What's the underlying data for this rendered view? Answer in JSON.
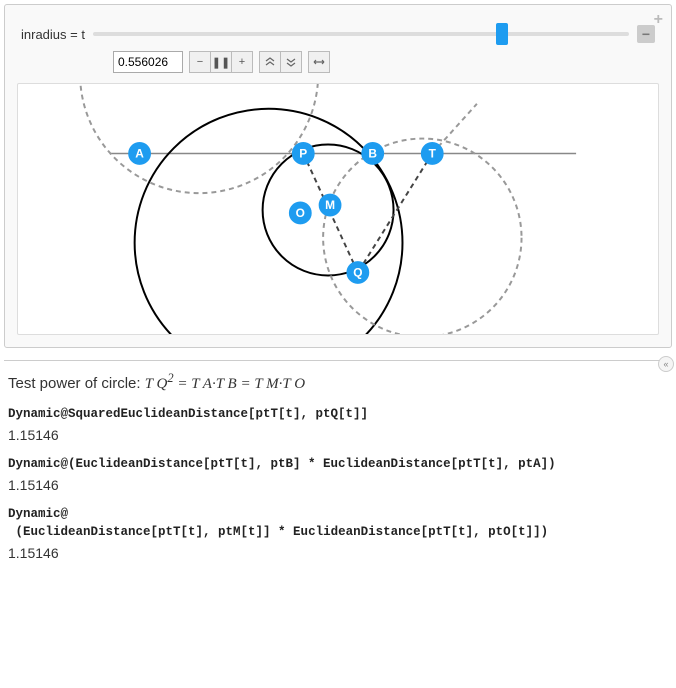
{
  "slider": {
    "label": "inradius = t",
    "value": "0.556026"
  },
  "buttons": {
    "minus_large": "−",
    "minus": "−",
    "pause": "❚❚",
    "plus": "+",
    "dup": "≫",
    "ddown": "≪",
    "lr": "↔",
    "corner_plus": "+",
    "chevron": "«"
  },
  "points": {
    "A": "A",
    "P": "P",
    "B": "B",
    "T": "T",
    "O": "O",
    "M": "M",
    "Q": "Q"
  },
  "caption": {
    "prefix": "Test power of circle: ",
    "eq_a": "T Q",
    "eq_sup": "2",
    "eq_b": " = T A·T B = T M·T O"
  },
  "code1": "Dynamic@SquaredEuclideanDistance[ptT[t], ptQ[t]]",
  "out1": "1.15146",
  "code2": "Dynamic@(EuclideanDistance[ptT[t], ptB] * EuclideanDistance[ptT[t], ptA])",
  "out2": "1.15146",
  "code3a": "Dynamic@",
  "code3b": " (EuclideanDistance[ptT[t], ptM[t]] * EuclideanDistance[ptT[t], ptO[t]])",
  "out3": "1.15146",
  "chart_data": {
    "type": "diagram",
    "parameter": {
      "name": "inradius t",
      "value": 0.556026
    },
    "points": {
      "A": [
        -2.0,
        0
      ],
      "P": [
        -0.35,
        0
      ],
      "B": [
        0.5,
        0
      ],
      "T": [
        1.1,
        0
      ],
      "O": [
        -0.35,
        -0.5
      ],
      "M": [
        -0.05,
        -0.42
      ],
      "Q": [
        0.3,
        -1.0
      ]
    },
    "horizontal_axis_y": 0,
    "circles": [
      {
        "style": "solid",
        "center_approx": [
          -0.75,
          -0.7
        ],
        "r_approx": 1.3
      },
      {
        "style": "solid",
        "center_approx": [
          -0.05,
          -0.42
        ],
        "r_approx": 0.65
      },
      {
        "style": "dashed",
        "center_approx": [
          -1.45,
          0.6
        ],
        "r_approx": 1.2,
        "partial": true
      },
      {
        "style": "dashed",
        "center_approx": [
          0.75,
          -0.75
        ],
        "r_approx": 0.95,
        "partial": true
      }
    ],
    "dashed_segments": [
      [
        "P",
        "Q"
      ],
      [
        "T",
        "Q"
      ]
    ]
  }
}
